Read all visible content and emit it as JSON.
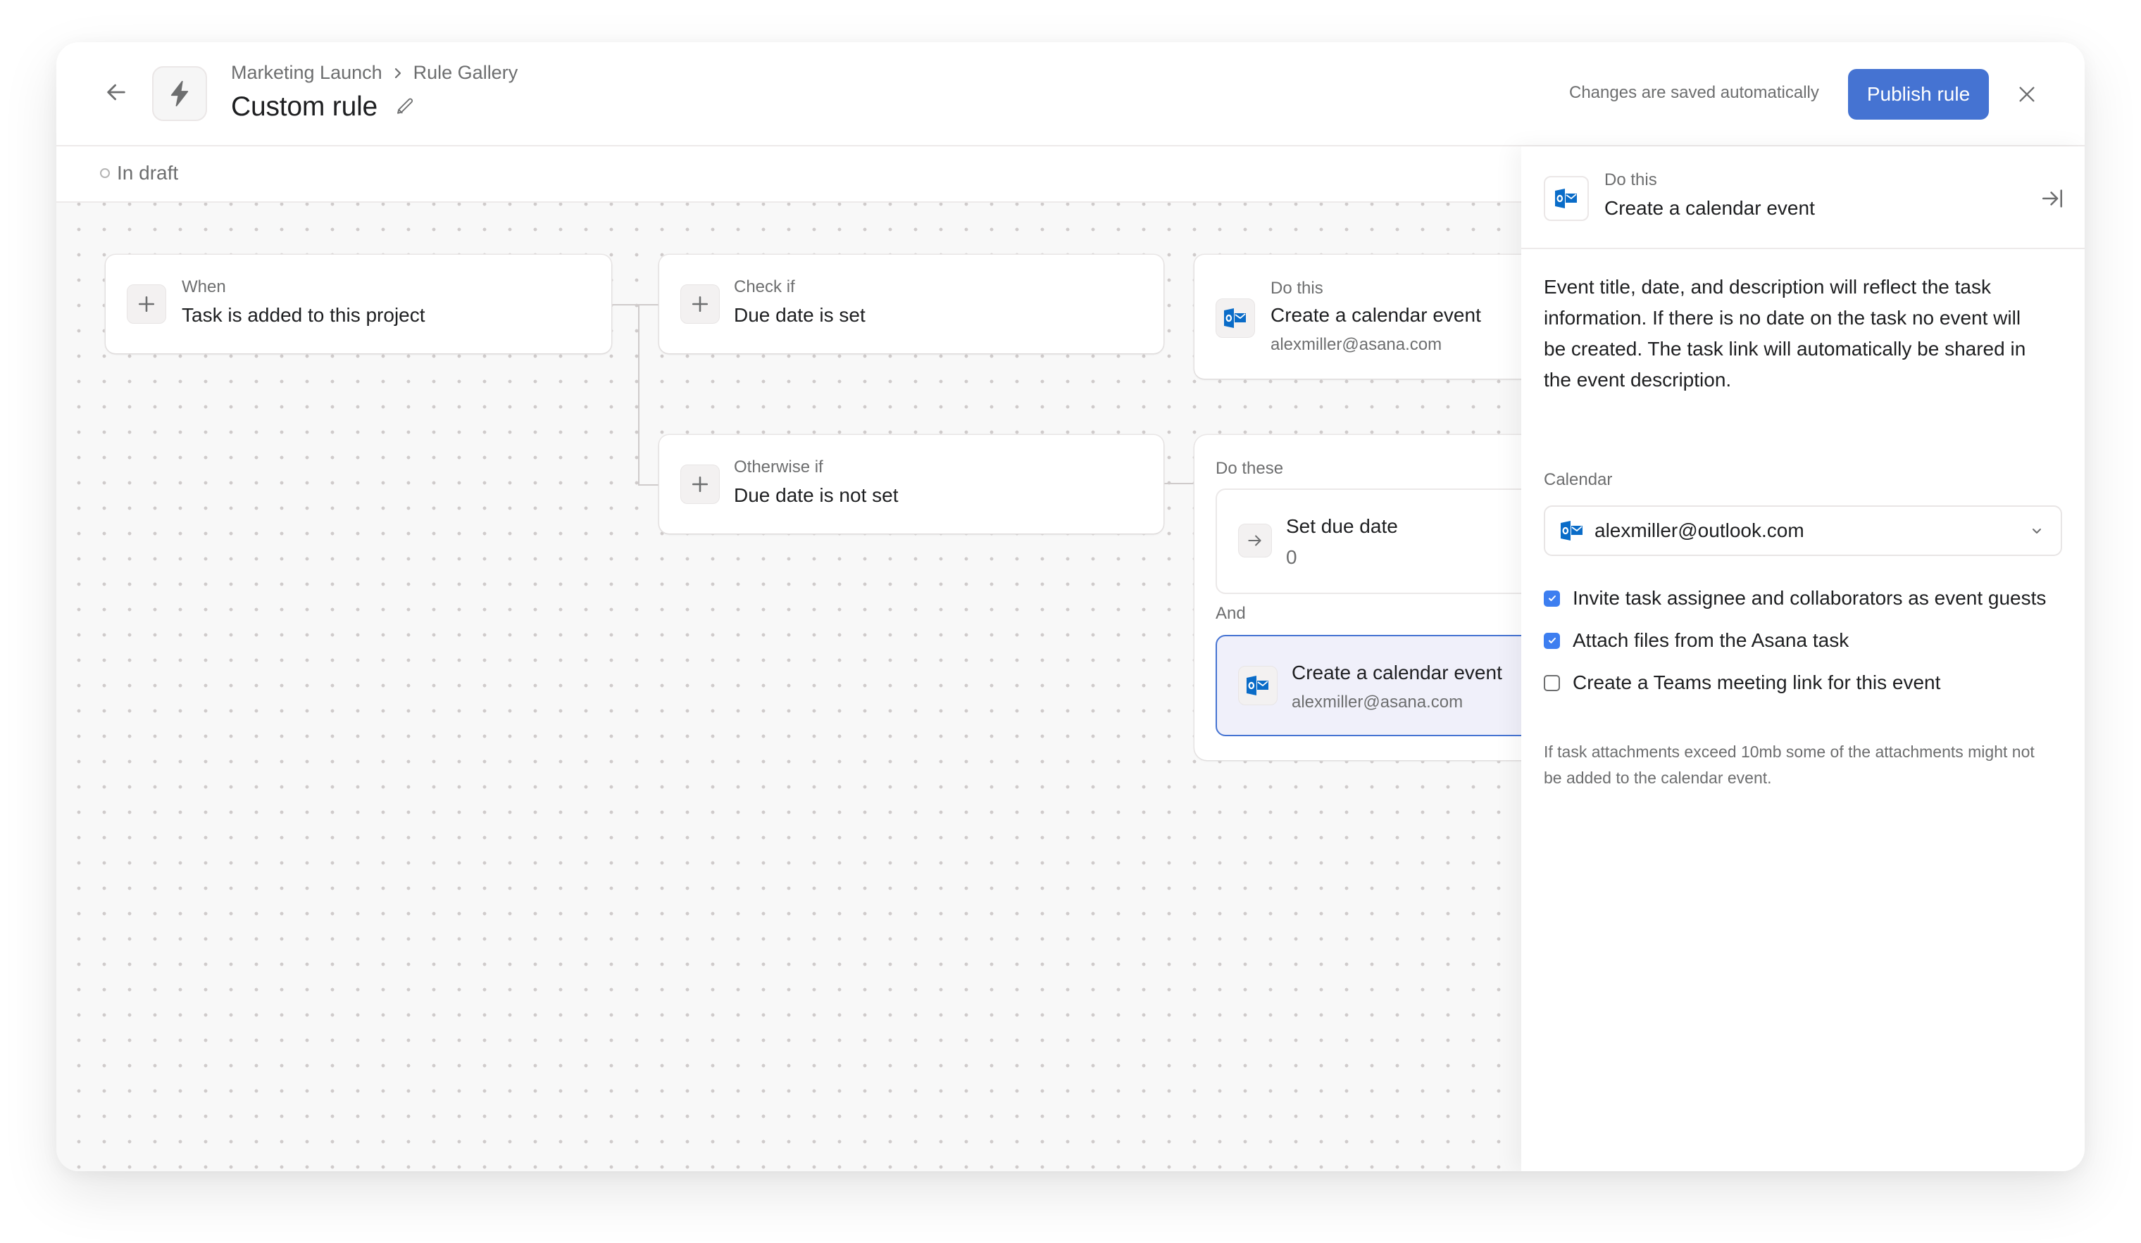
{
  "header": {
    "breadcrumb": [
      "Marketing Launch",
      "Rule Gallery"
    ],
    "title": "Custom rule",
    "saved_text": "Changes are saved automatically",
    "publish_label": "Publish rule",
    "icons": {
      "back": "arrow-left-icon",
      "rule": "lightning-bolt-icon",
      "edit": "pencil-icon",
      "close": "close-icon",
      "separator": "chevron-right-icon"
    }
  },
  "status": {
    "label": "In draft"
  },
  "canvas": {
    "trigger": {
      "label": "When",
      "value": "Task is added to this project",
      "icon": "plus-icon"
    },
    "check": {
      "label": "Check if",
      "value": "Due date is set",
      "icon": "plus-icon"
    },
    "otherwise": {
      "label": "Otherwise if",
      "value": "Due date is not set",
      "icon": "plus-icon"
    },
    "action": {
      "label": "Do this",
      "value": "Create a calendar event",
      "sub": "alexmiller@asana.com",
      "icon": "outlook-icon"
    },
    "group": {
      "label": "Do these",
      "and_label": "And",
      "items": [
        {
          "value": "Set due date",
          "sub": "0",
          "icon": "arrow-right-icon",
          "selected": false
        },
        {
          "value": "Create a calendar event",
          "sub": "alexmiller@asana.com",
          "icon": "outlook-icon",
          "selected": true
        }
      ]
    }
  },
  "panel": {
    "kicker": "Do this",
    "title": "Create a calendar event",
    "description": "Event title, date, and description will reflect the task information. If there is no date on the task no event will be created. The task link will automatically be shared in the event description.",
    "calendar_label": "Calendar",
    "calendar_value": "alexmiller@outlook.com",
    "checkboxes": [
      {
        "label": "Invite task assignee and collaborators as event guests",
        "checked": true
      },
      {
        "label": "Attach files from the Asana task",
        "checked": true
      },
      {
        "label": "Create a Teams meeting link for this event",
        "checked": false
      }
    ],
    "note": "If task attachments exceed 10mb some of the attachments might not be added to the calendar event.",
    "icons": {
      "collapse": "collapse-panel-icon",
      "calendar": "outlook-icon",
      "dropdown": "chevron-down-icon"
    }
  },
  "colors": {
    "accent": "#4573d2",
    "checkbox": "#3d7ef0",
    "selected_card_bg": "#f0f0fa",
    "selected_card_border": "#4573d2",
    "outlook_blue": "#0a6cc8"
  }
}
